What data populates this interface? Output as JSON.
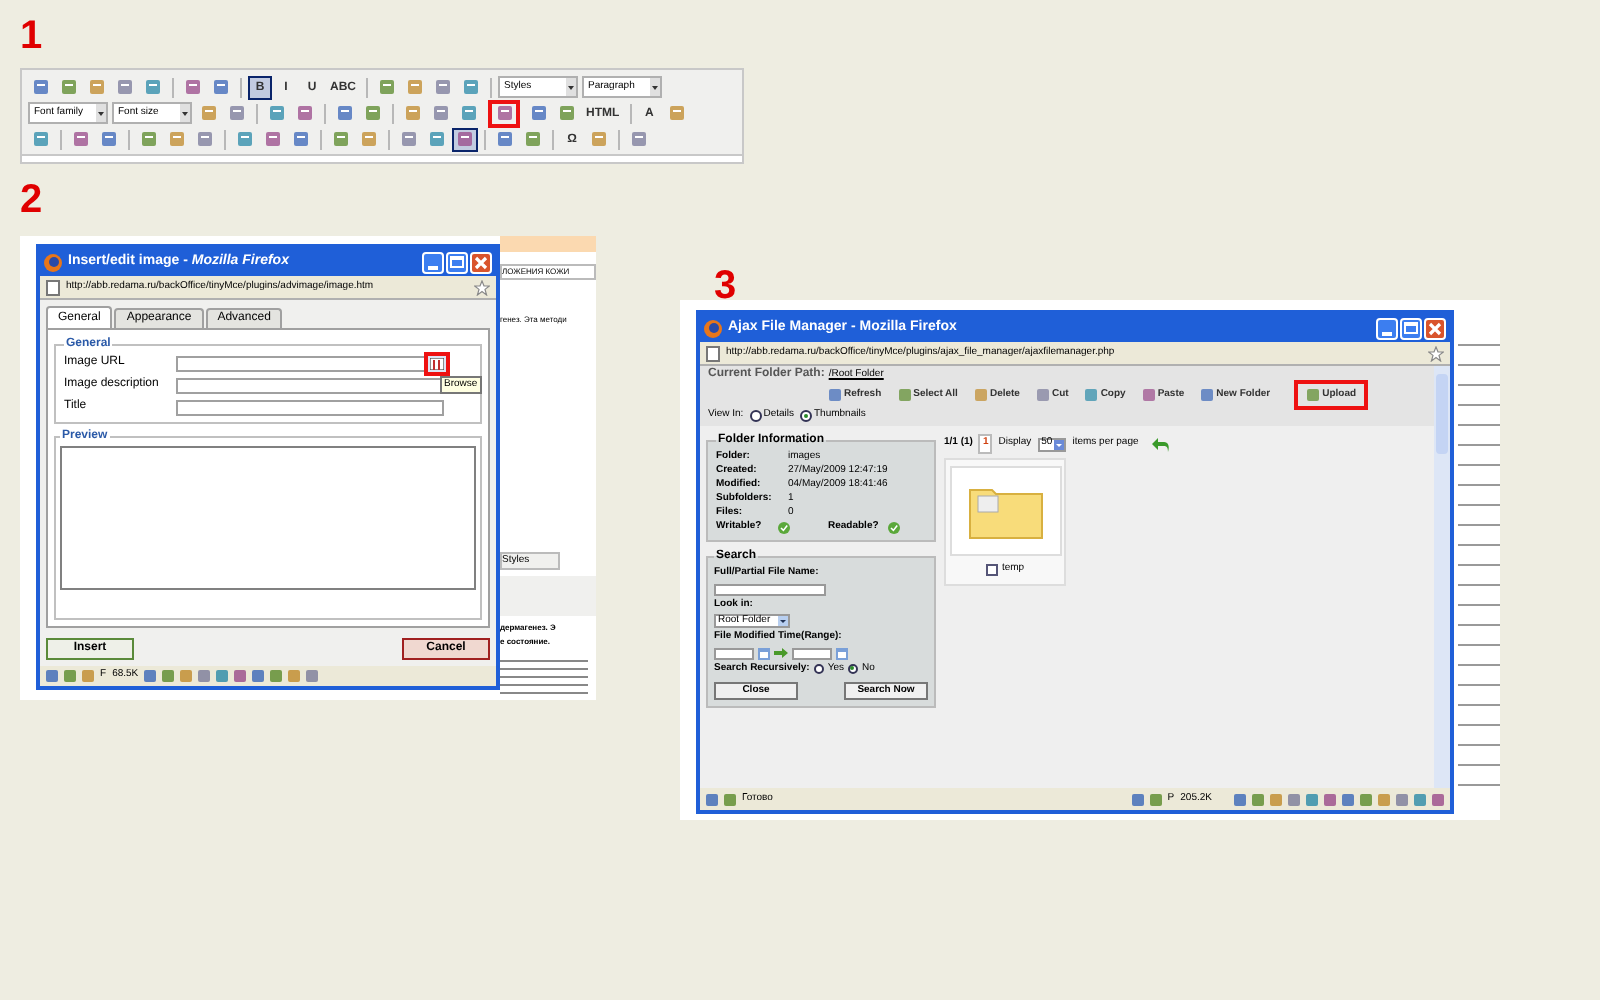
{
  "editor": {
    "number": "1",
    "rows": [
      [
        {
          "kind": "icon",
          "pressed": false,
          "highlighted": false
        },
        {
          "kind": "icon",
          "pressed": false,
          "highlighted": false
        },
        {
          "kind": "icon",
          "pressed": false,
          "highlighted": false
        },
        {
          "kind": "icon",
          "pressed": false,
          "highlighted": false
        },
        {
          "kind": "icon",
          "pressed": false,
          "highlighted": false
        },
        {
          "kind": "sep"
        },
        {
          "kind": "icon",
          "pressed": false,
          "highlighted": false
        },
        {
          "kind": "icon",
          "pressed": false,
          "highlighted": false
        },
        {
          "kind": "sep"
        },
        {
          "kind": "text",
          "text": "B",
          "pressed": true,
          "highlighted": false
        },
        {
          "kind": "text",
          "text": "I",
          "pressed": false,
          "highlighted": false
        },
        {
          "kind": "text",
          "text": "U",
          "pressed": false,
          "highlighted": false
        },
        {
          "kind": "text",
          "text": "ABC",
          "pressed": false,
          "highlighted": false
        },
        {
          "kind": "sep"
        },
        {
          "kind": "icon",
          "pressed": false,
          "highlighted": false
        },
        {
          "kind": "icon",
          "pressed": false,
          "highlighted": false
        },
        {
          "kind": "icon",
          "pressed": false,
          "highlighted": false
        },
        {
          "kind": "icon",
          "pressed": false,
          "highlighted": false
        },
        {
          "kind": "sep"
        },
        {
          "kind": "select",
          "text": "Styles"
        },
        {
          "kind": "select",
          "text": "Paragraph"
        }
      ],
      [
        {
          "kind": "select",
          "text": "Font family"
        },
        {
          "kind": "select",
          "text": "Font size"
        },
        {
          "kind": "icon",
          "pressed": false,
          "highlighted": false
        },
        {
          "kind": "icon",
          "pressed": false,
          "highlighted": false
        },
        {
          "kind": "sep"
        },
        {
          "kind": "icon",
          "pressed": false,
          "highlighted": false
        },
        {
          "kind": "icon",
          "pressed": false,
          "highlighted": false
        },
        {
          "kind": "sep"
        },
        {
          "kind": "icon",
          "pressed": false,
          "highlighted": false
        },
        {
          "kind": "icon",
          "pressed": false,
          "highlighted": false
        },
        {
          "kind": "sep"
        },
        {
          "kind": "icon",
          "pressed": false,
          "highlighted": false
        },
        {
          "kind": "icon",
          "pressed": false,
          "highlighted": false
        },
        {
          "kind": "icon",
          "pressed": false,
          "highlighted": false
        },
        {
          "kind": "icon",
          "pressed": false,
          "highlighted": true
        },
        {
          "kind": "icon",
          "pressed": false,
          "highlighted": false
        },
        {
          "kind": "icon",
          "pressed": false,
          "highlighted": false
        },
        {
          "kind": "text",
          "text": "HTML",
          "pressed": false,
          "highlighted": false
        },
        {
          "kind": "sep"
        },
        {
          "kind": "text",
          "text": "A",
          "pressed": false,
          "highlighted": false
        },
        {
          "kind": "icon",
          "pressed": false,
          "highlighted": false
        }
      ],
      [
        {
          "kind": "icon",
          "pressed": false,
          "highlighted": false
        },
        {
          "kind": "sep"
        },
        {
          "kind": "icon",
          "pressed": false,
          "highlighted": false
        },
        {
          "kind": "icon",
          "pressed": false,
          "highlighted": false
        },
        {
          "kind": "sep"
        },
        {
          "kind": "icon",
          "pressed": false,
          "highlighted": false
        },
        {
          "kind": "icon",
          "pressed": false,
          "highlighted": false
        },
        {
          "kind": "icon",
          "pressed": false,
          "highlighted": false
        },
        {
          "kind": "sep"
        },
        {
          "kind": "icon",
          "pressed": false,
          "highlighted": false
        },
        {
          "kind": "icon",
          "pressed": false,
          "highlighted": false
        },
        {
          "kind": "icon",
          "pressed": false,
          "highlighted": false
        },
        {
          "kind": "sep"
        },
        {
          "kind": "icon",
          "pressed": false,
          "highlighted": false
        },
        {
          "kind": "icon",
          "pressed": false,
          "highlighted": false
        },
        {
          "kind": "sep"
        },
        {
          "kind": "icon",
          "pressed": false,
          "highlighted": false
        },
        {
          "kind": "icon",
          "pressed": false,
          "highlighted": false
        },
        {
          "kind": "icon",
          "pressed": true,
          "highlighted": false
        },
        {
          "kind": "sep"
        },
        {
          "kind": "icon",
          "pressed": false,
          "highlighted": false
        },
        {
          "kind": "icon",
          "pressed": false,
          "highlighted": false
        },
        {
          "kind": "sep"
        },
        {
          "kind": "text",
          "text": "Ω",
          "pressed": false,
          "highlighted": false
        },
        {
          "kind": "icon",
          "pressed": false,
          "highlighted": false
        },
        {
          "kind": "sep"
        },
        {
          "kind": "icon",
          "pressed": false,
          "highlighted": false
        }
      ]
    ]
  },
  "image_dialog": {
    "number": "2",
    "title": "Insert/edit image - *Mozilla Firefox*",
    "url": "http://abb.redama.ru/backOffice/tinyMce/plugins/advimage/image.htm",
    "background_texts": [
      "ЛОЖЕНИЯ КОЖИ",
      "генез. Эта методи",
      "Styles",
      "дермагенез. Э",
      "е состояние."
    ],
    "tabs": [
      {
        "label": "General",
        "selected": true
      },
      {
        "label": "Appearance",
        "selected": false
      },
      {
        "label": "Advanced",
        "selected": false
      }
    ],
    "general_legend": "General",
    "fields": [
      {
        "label": "Image URL",
        "browse": true
      },
      {
        "label": "Image description",
        "browse": false
      },
      {
        "label": "Title",
        "browse": false
      }
    ],
    "browse_tooltip": "Browse",
    "preview_legend": "Preview",
    "buttons": [
      {
        "label": "Insert",
        "kind": "ok"
      },
      {
        "label": "Cancel",
        "kind": "cancel"
      }
    ],
    "status": [
      "F",
      "68.5K"
    ]
  },
  "file_manager": {
    "number": "3",
    "title": "Ajax File Manager - Mozilla Firefox",
    "url": "http://abb.redama.ru/backOffice/tinyMce/plugins/ajax_file_manager/ajaxfilemanager.php",
    "path_label": "Current Folder Path:",
    "path": "/Root Folder",
    "actions": [
      {
        "label": "Refresh",
        "highlighted": false
      },
      {
        "label": "Select All",
        "highlighted": false
      },
      {
        "label": "Delete",
        "highlighted": false
      },
      {
        "label": "Cut",
        "highlighted": false
      },
      {
        "label": "Copy",
        "highlighted": false
      },
      {
        "label": "Paste",
        "highlighted": false
      },
      {
        "label": "New Folder",
        "highlighted": false
      },
      {
        "label": "Upload",
        "highlighted": true
      }
    ],
    "view_label": "View In:",
    "views": [
      {
        "label": "Details",
        "selected": false
      },
      {
        "label": "Thumbnails",
        "selected": true
      }
    ],
    "info_title": "Folder Information",
    "info": [
      {
        "label": "Folder:",
        "value": "images"
      },
      {
        "label": "Created:",
        "value": "27/May/2009 12:47:19"
      },
      {
        "label": "Modified:",
        "value": "04/May/2009 18:41:46"
      },
      {
        "label": "Subfolders:",
        "value": "1"
      },
      {
        "label": "Files:",
        "value": "0"
      }
    ],
    "writable": "Writable?",
    "readable": "Readable?",
    "search_title": "Search",
    "name_label": "Full/Partial File Name:",
    "look_in_label": "Look in:",
    "look_in": "Root Folder",
    "time_label": "File Modified Time(Range):",
    "recursive_label": "Search Recursively:",
    "recursive": [
      {
        "label": "Yes",
        "selected": false
      },
      {
        "label": "No",
        "selected": true
      }
    ],
    "search_buttons": [
      "Close",
      "Search Now"
    ],
    "page_info": "1/1 (1)",
    "page": "1",
    "display_label": "Display",
    "per_page": "50",
    "per_page_label": "items per page",
    "files": [
      {
        "name": "temp",
        "checked": false
      }
    ],
    "status": [
      "Готово",
      "P",
      "205.2K"
    ]
  }
}
